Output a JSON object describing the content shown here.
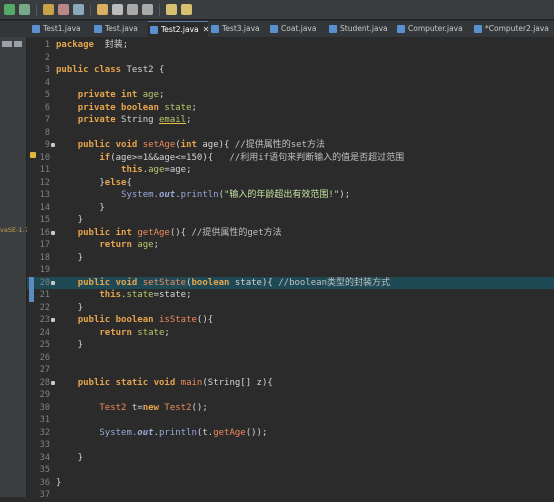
{
  "toolbar": {
    "icons": [
      "run-icon",
      "debug-icon",
      "new-icon",
      "save-icon",
      "build-icon",
      "search-icon",
      "open-type-icon",
      "prev-icon",
      "next-icon",
      "back-icon",
      "forward-icon"
    ]
  },
  "tabs": [
    {
      "label": "Test1.java",
      "active": false
    },
    {
      "label": "Test.java",
      "active": false
    },
    {
      "label": "Test2.java",
      "active": true,
      "close": "✕"
    },
    {
      "label": "Test3.java",
      "active": false
    },
    {
      "label": "Coat.java",
      "active": false
    },
    {
      "label": "Student.java",
      "active": false
    },
    {
      "label": "Computer.java",
      "active": false
    },
    {
      "label": "*Computer2.java",
      "active": false
    }
  ],
  "left_strip": {
    "label": "vaSE-1.7"
  },
  "editor": {
    "highlighted_line": 20,
    "lines": [
      {
        "n": "1",
        "parts": [
          [
            "kw",
            "package"
          ],
          [
            "",
            "  封装;"
          ]
        ]
      },
      {
        "n": "2",
        "parts": []
      },
      {
        "n": "3",
        "parts": [
          [
            "kw",
            "public"
          ],
          [
            "",
            " "
          ],
          [
            "kw",
            "class"
          ],
          [
            "",
            " "
          ],
          [
            "",
            "Test2 {"
          ]
        ]
      },
      {
        "n": "4",
        "parts": []
      },
      {
        "n": "5",
        "parts": [
          [
            "",
            "    "
          ],
          [
            "kw",
            "private"
          ],
          [
            "",
            " "
          ],
          [
            "ty",
            "int"
          ],
          [
            "",
            " "
          ],
          [
            "fld",
            "age"
          ],
          [
            "",
            ";"
          ]
        ]
      },
      {
        "n": "6",
        "parts": [
          [
            "",
            "    "
          ],
          [
            "kw",
            "private"
          ],
          [
            "",
            " "
          ],
          [
            "ty",
            "boolean"
          ],
          [
            "",
            " "
          ],
          [
            "fld",
            "state"
          ],
          [
            "",
            ";"
          ]
        ]
      },
      {
        "n": "7",
        "parts": [
          [
            "",
            "    "
          ],
          [
            "kw",
            "private"
          ],
          [
            "",
            " "
          ],
          [
            "",
            "String "
          ],
          [
            "fld ulw",
            "email"
          ],
          [
            "",
            ";"
          ]
        ]
      },
      {
        "n": "8",
        "parts": []
      },
      {
        "n": "9",
        "fold": true,
        "parts": [
          [
            "",
            "    "
          ],
          [
            "kw",
            "public"
          ],
          [
            "",
            " "
          ],
          [
            "kw",
            "void"
          ],
          [
            "",
            " "
          ],
          [
            "mth",
            "setAge"
          ],
          [
            "",
            "("
          ],
          [
            "ty",
            "int"
          ],
          [
            "",
            " age){ "
          ],
          [
            "cm",
            "//提供属性的set方法"
          ]
        ]
      },
      {
        "n": "10",
        "parts": [
          [
            "",
            "        "
          ],
          [
            "kw",
            "if"
          ],
          [
            "",
            "(age>=1&&age<=150){   "
          ],
          [
            "cm",
            "//利用if语句来判断输入的值是否超过范围"
          ]
        ]
      },
      {
        "n": "11",
        "parts": [
          [
            "",
            "            "
          ],
          [
            "kw",
            "this"
          ],
          [
            "",
            "."
          ],
          [
            "fld",
            "age"
          ],
          [
            "",
            "=age;"
          ]
        ]
      },
      {
        "n": "12",
        "parts": [
          [
            "",
            "        }"
          ],
          [
            "kw",
            "else"
          ],
          [
            "",
            "{"
          ]
        ]
      },
      {
        "n": "13",
        "parts": [
          [
            "",
            "            "
          ],
          [
            "sysc",
            "System."
          ],
          [
            "out",
            "out"
          ],
          [
            "",
            "."
          ],
          [
            "sysc",
            "println"
          ],
          [
            "",
            "("
          ],
          [
            "str",
            "\"输入的年龄超出有效范围!\""
          ],
          [
            "",
            ");"
          ]
        ]
      },
      {
        "n": "14",
        "parts": [
          [
            "",
            "        }"
          ]
        ]
      },
      {
        "n": "15",
        "parts": [
          [
            "",
            "    }"
          ]
        ]
      },
      {
        "n": "16",
        "fold": true,
        "parts": [
          [
            "",
            "    "
          ],
          [
            "kw",
            "public"
          ],
          [
            "",
            " "
          ],
          [
            "ty",
            "int"
          ],
          [
            "",
            " "
          ],
          [
            "mth",
            "getAge"
          ],
          [
            "",
            "(){ "
          ],
          [
            "cm",
            "//提供属性的get方法"
          ]
        ]
      },
      {
        "n": "17",
        "parts": [
          [
            "",
            "        "
          ],
          [
            "kw",
            "return"
          ],
          [
            "",
            " "
          ],
          [
            "fld",
            "age"
          ],
          [
            "",
            ";"
          ]
        ]
      },
      {
        "n": "18",
        "parts": [
          [
            "",
            "    }"
          ]
        ]
      },
      {
        "n": "19",
        "parts": []
      },
      {
        "n": "20",
        "fold": true,
        "parts": [
          [
            "",
            "    "
          ],
          [
            "kw",
            "public"
          ],
          [
            "",
            " "
          ],
          [
            "kw",
            "void"
          ],
          [
            "",
            " "
          ],
          [
            "mth",
            "setState"
          ],
          [
            "",
            "("
          ],
          [
            "ty",
            "boolean"
          ],
          [
            "",
            " state){ "
          ],
          [
            "cm",
            "//boolean类型的封装方式"
          ]
        ]
      },
      {
        "n": "21",
        "parts": [
          [
            "",
            "        "
          ],
          [
            "kw",
            "this"
          ],
          [
            "",
            "."
          ],
          [
            "fld",
            "state"
          ],
          [
            "",
            "=state;"
          ]
        ]
      },
      {
        "n": "22",
        "parts": [
          [
            "",
            "    }"
          ]
        ]
      },
      {
        "n": "23",
        "fold": true,
        "parts": [
          [
            "",
            "    "
          ],
          [
            "kw",
            "public"
          ],
          [
            "",
            " "
          ],
          [
            "ty",
            "boolean"
          ],
          [
            "",
            " "
          ],
          [
            "mth",
            "isState"
          ],
          [
            "",
            "(){"
          ]
        ]
      },
      {
        "n": "24",
        "parts": [
          [
            "",
            "        "
          ],
          [
            "kw",
            "return"
          ],
          [
            "",
            " "
          ],
          [
            "fld",
            "state"
          ],
          [
            "",
            ";"
          ]
        ]
      },
      {
        "n": "25",
        "parts": [
          [
            "",
            "    }"
          ]
        ]
      },
      {
        "n": "26",
        "parts": []
      },
      {
        "n": "27",
        "parts": []
      },
      {
        "n": "28",
        "fold": true,
        "parts": [
          [
            "",
            "    "
          ],
          [
            "kw",
            "public"
          ],
          [
            "",
            " "
          ],
          [
            "kw",
            "static"
          ],
          [
            "",
            " "
          ],
          [
            "kw",
            "void"
          ],
          [
            "",
            " "
          ],
          [
            "mth",
            "main"
          ],
          [
            "",
            "(String[] z){"
          ]
        ]
      },
      {
        "n": "29",
        "parts": []
      },
      {
        "n": "30",
        "parts": [
          [
            "",
            "        "
          ],
          [
            "cls",
            "Test2"
          ],
          [
            "",
            " t="
          ],
          [
            "kw",
            "new"
          ],
          [
            "",
            " "
          ],
          [
            "cls",
            "Test2"
          ],
          [
            "",
            "();"
          ]
        ]
      },
      {
        "n": "31",
        "parts": []
      },
      {
        "n": "32",
        "parts": [
          [
            "",
            "        "
          ],
          [
            "sysc",
            "System."
          ],
          [
            "out",
            "out"
          ],
          [
            "",
            "."
          ],
          [
            "sysc",
            "println"
          ],
          [
            "",
            "(t."
          ],
          [
            "mth",
            "getAge"
          ],
          [
            "",
            "());"
          ]
        ]
      },
      {
        "n": "33",
        "parts": []
      },
      {
        "n": "34",
        "parts": [
          [
            "",
            "    }"
          ]
        ]
      },
      {
        "n": "35",
        "parts": []
      },
      {
        "n": "36",
        "parts": [
          [
            "",
            "}"
          ]
        ]
      },
      {
        "n": "37",
        "parts": []
      }
    ]
  }
}
